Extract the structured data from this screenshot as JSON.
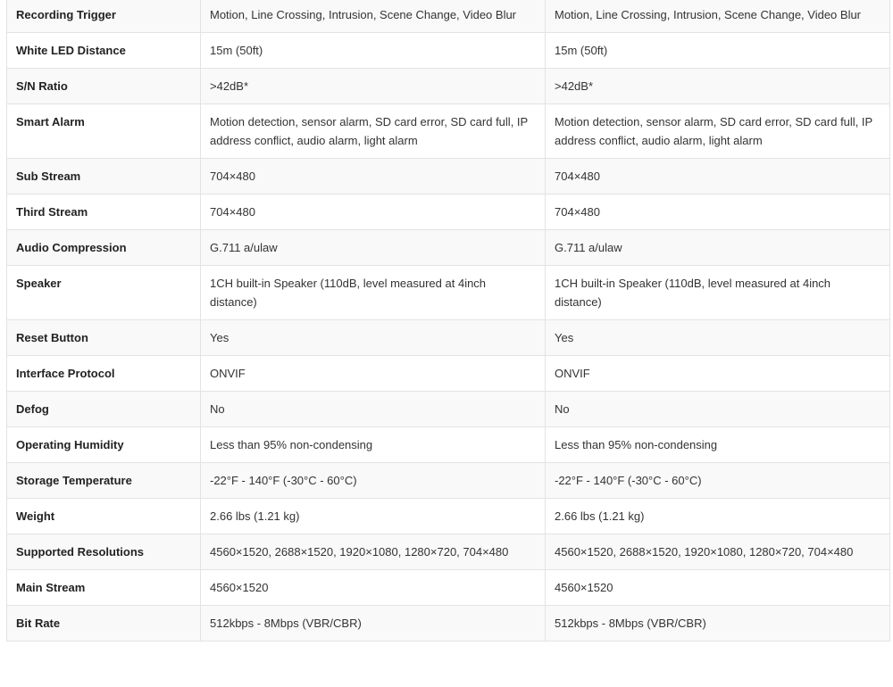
{
  "specs": {
    "rows": [
      {
        "label": "Recording Trigger",
        "a": "Motion, Line Crossing, Intrusion, Scene Change, Video Blur",
        "b": "Motion, Line Crossing, Intrusion, Scene Change, Video Blur"
      },
      {
        "label": "White LED Distance",
        "a": "15m (50ft)",
        "b": "15m (50ft)"
      },
      {
        "label": "S/N Ratio",
        "a": ">42dB*",
        "b": ">42dB*"
      },
      {
        "label": "Smart Alarm",
        "a": "Motion detection, sensor alarm, SD card error, SD card full, IP address conflict, audio alarm, light alarm",
        "b": "Motion detection, sensor alarm, SD card error, SD card full, IP address conflict, audio alarm, light alarm"
      },
      {
        "label": "Sub Stream",
        "a": "704×480",
        "b": "704×480"
      },
      {
        "label": "Third Stream",
        "a": "704×480",
        "b": "704×480"
      },
      {
        "label": "Audio Compression",
        "a": "G.711 a/ulaw",
        "b": "G.711 a/ulaw"
      },
      {
        "label": "Speaker",
        "a": "1CH built-in Speaker (110dB, level measured at 4inch distance)",
        "b": "1CH built-in Speaker (110dB, level measured at 4inch distance)"
      },
      {
        "label": "Reset Button",
        "a": "Yes",
        "b": "Yes"
      },
      {
        "label": "Interface Protocol",
        "a": "ONVIF",
        "b": "ONVIF"
      },
      {
        "label": "Defog",
        "a": "No",
        "b": "No"
      },
      {
        "label": "Operating Humidity",
        "a": "Less than 95% non-condensing",
        "b": "Less than 95% non-condensing"
      },
      {
        "label": "Storage Temperature",
        "a": "-22°F - 140°F (-30°C - 60°C)",
        "b": "-22°F - 140°F (-30°C - 60°C)"
      },
      {
        "label": "Weight",
        "a": "2.66 lbs (1.21 kg)",
        "b": "2.66 lbs (1.21 kg)"
      },
      {
        "label": "Supported Resolutions",
        "a": "4560×1520, 2688×1520, 1920×1080, 1280×720, 704×480",
        "b": "4560×1520, 2688×1520, 1920×1080, 1280×720, 704×480"
      },
      {
        "label": "Main Stream",
        "a": "4560×1520",
        "b": "4560×1520"
      },
      {
        "label": "Bit Rate",
        "a": "512kbps - 8Mbps (VBR/CBR)",
        "b": "512kbps - 8Mbps (VBR/CBR)"
      }
    ]
  }
}
